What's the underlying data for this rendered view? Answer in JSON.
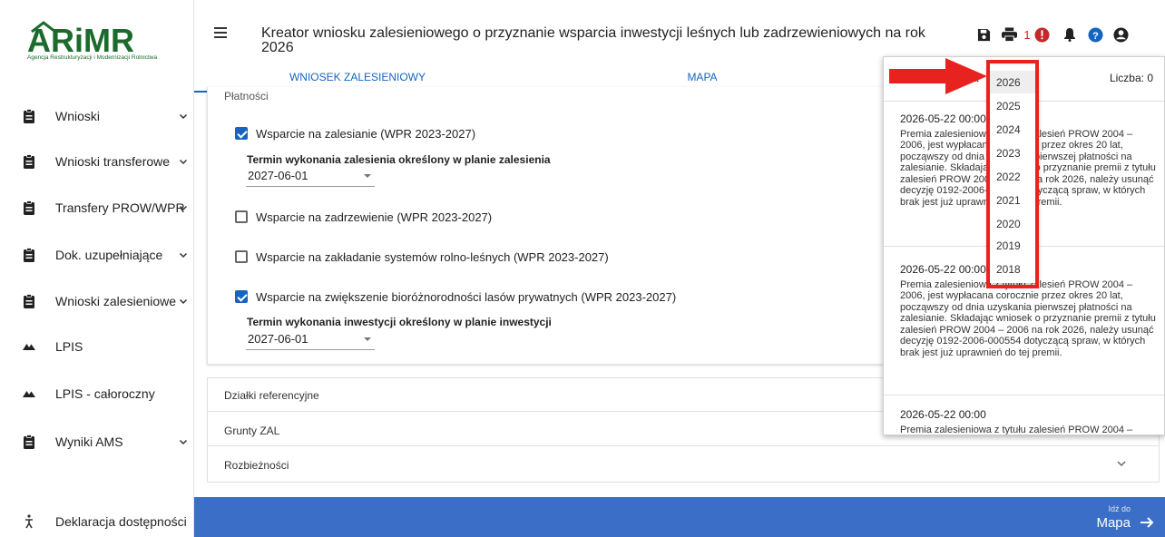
{
  "app": {
    "logo_text": "ARiMR",
    "logo_subtitle": "Agencja Restrukturyzacji i Modernizacji Rolnictwa",
    "title": "Kreator wniosku zalesieniowego o przyznanie wsparcia inwestycji leśnych lub zadrzewieniowych na rok 2026",
    "notification_count": "1"
  },
  "sidebar": {
    "items": [
      {
        "label": "Wnioski",
        "icon": "clipboard-icon",
        "expandable": true
      },
      {
        "label": "Wnioski transferowe",
        "icon": "clipboard-icon",
        "expandable": true
      },
      {
        "label": "Transfery PROW/WPR",
        "icon": "clipboard-icon",
        "expandable": true
      },
      {
        "label": "Dok. uzupełniające",
        "icon": "clipboard-icon",
        "expandable": true
      },
      {
        "label": "Wnioski zalesieniowe",
        "icon": "clipboard-icon",
        "expandable": true
      },
      {
        "label": "LPIS",
        "icon": "mountains-icon",
        "expandable": false
      },
      {
        "label": "LPIS - całoroczny",
        "icon": "mountains-icon",
        "expandable": false
      },
      {
        "label": "Wyniki AMS",
        "icon": "clipboard-icon",
        "expandable": true
      }
    ],
    "accessibility": "Deklaracja dostępności"
  },
  "tabs": [
    {
      "label": "WNIOSEK ZALESIENIOWY",
      "active": true
    },
    {
      "label": "MAPA",
      "active": false
    }
  ],
  "payments": {
    "section_label": "Płatności",
    "options": [
      {
        "label": "Wsparcie na zalesianie (WPR 2023-2027)",
        "checked": true,
        "field_label": "Termin wykonania zalesienia określony w planie zalesienia",
        "field_value": "2027-06-01"
      },
      {
        "label": "Wsparcie na zadrzewienie (WPR 2023-2027)",
        "checked": false
      },
      {
        "label": "Wsparcie na zakładanie systemów rolno-leśnych (WPR 2023-2027)",
        "checked": false
      },
      {
        "label": "Wsparcie na zwiększenie bioróżnorodności lasów prywatnych (WPR 2023-2027)",
        "checked": true,
        "field_label": "Termin wykonania inwestycji określony w planie inwestycji",
        "field_value": "2027-06-01"
      }
    ]
  },
  "accordions": [
    "Działki referencyjne",
    "Grunty ZAL",
    "Rozbieżności"
  ],
  "footer": {
    "goto_small": "Idź do",
    "goto_big": "Mapa"
  },
  "notifications": {
    "count_label": "Liczba: 0",
    "year_label_partial": "ra",
    "items": [
      {
        "date": "2026-05-22 00:00",
        "text": "Premia zalesieniowa z tytułu zalesień PROW 2004 – 2006, jest wypłacana corocznie przez okres 20 lat, począwszy od dnia uzyskania pierwszej płatności na zalesianie. Składając wniosek o przyznanie premii z tytułu zalesień PROW 2004 – 2006 na rok 2026, należy usunąć decyzję 0192-2006-000552 dotyczącą spraw, w których brak jest już uprawnień do tej premii."
      },
      {
        "date": "2026-05-22 00:00",
        "text": "Premia zalesieniowa z tytułu zalesień PROW 2004 – 2006, jest wypłacana corocznie przez okres 20 lat, począwszy od dnia uzyskania pierwszej płatności na zalesianie. Składając wniosek o przyznanie premii z tytułu zalesień PROW 2004 – 2006 na rok 2026, należy usunąć decyzję 0192-2006-000554 dotyczącą spraw, w których brak jest już uprawnień do tej premii."
      },
      {
        "date": "2026-05-22 00:00",
        "text": "Premia zalesieniowa z tytułu zalesień PROW 2004 –"
      }
    ]
  },
  "year_dropdown": {
    "selected": "2026",
    "options": [
      "2026",
      "2025",
      "2024",
      "2023",
      "2022",
      "2021",
      "2020",
      "2019",
      "2018"
    ]
  },
  "colors": {
    "brand": "#1c6b2c",
    "accent": "#1565c0",
    "footer": "#3b6ec6",
    "highlight": "#e8231f",
    "alert": "#c62828"
  }
}
